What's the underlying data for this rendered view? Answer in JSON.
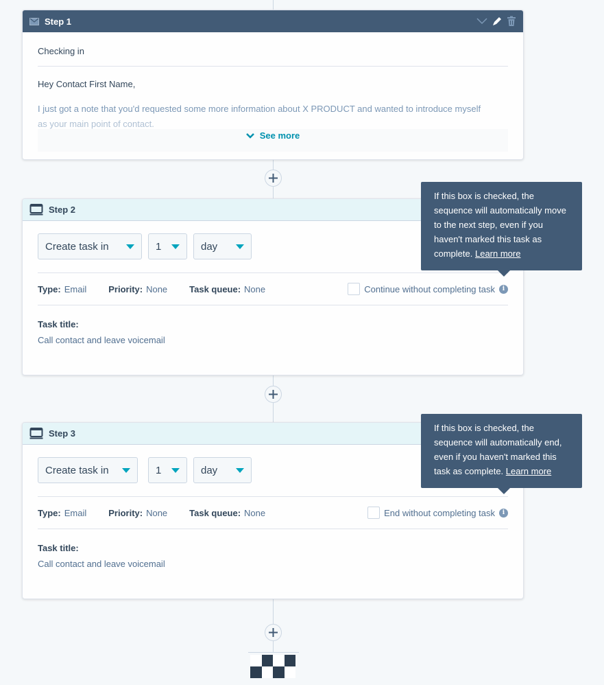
{
  "steps": [
    {
      "title": "Step 1",
      "type_icon": "email-icon",
      "header_icons": [
        "chevron-down-icon",
        "pencil-icon",
        "trash-icon"
      ],
      "email": {
        "subject": "Checking in",
        "greeting": "Hey Contact First Name,",
        "body_line1": "I just got a note that you'd requested some more information about X PRODUCT and wanted to introduce myself",
        "body_line2": "as your main point of contact.",
        "see_more": "See more"
      }
    },
    {
      "title": "Step 2",
      "type_icon": "task-icon",
      "selects": {
        "action": "Create task in",
        "count": "1",
        "unit": "day"
      },
      "meta": {
        "type_label": "Type:",
        "type_value": "Email",
        "priority_label": "Priority:",
        "priority_value": "None",
        "queue_label": "Task queue:",
        "queue_value": "None"
      },
      "checkbox_label": "Continue without completing task",
      "checkbox_checked": false,
      "task_title_label": "Task title:",
      "task_title_value": "Call contact and leave voicemail",
      "tooltip": {
        "text": "If this box is checked, the sequence will automatically move to the next step, even if you haven't marked this task as complete.",
        "link": "Learn more"
      }
    },
    {
      "title": "Step 3",
      "type_icon": "task-icon",
      "selects": {
        "action": "Create task in",
        "count": "1",
        "unit": "day"
      },
      "meta": {
        "type_label": "Type:",
        "type_value": "Email",
        "priority_label": "Priority:",
        "priority_value": "None",
        "queue_label": "Task queue:",
        "queue_value": "None"
      },
      "checkbox_label": "End without completing task",
      "checkbox_checked": false,
      "task_title_label": "Task title:",
      "task_title_value": "Call contact and leave voicemail",
      "tooltip": {
        "text": "If this box is checked, the sequence will automatically end, even if you haven't marked this task as complete.",
        "link": "Learn more"
      }
    }
  ],
  "info_glyph": "i",
  "colors": {
    "header_dark": "#425b76",
    "header_light": "#e5f5f8",
    "accent": "#00a4bd",
    "link": "#0091ae",
    "tooltip_bg": "#425b76"
  }
}
